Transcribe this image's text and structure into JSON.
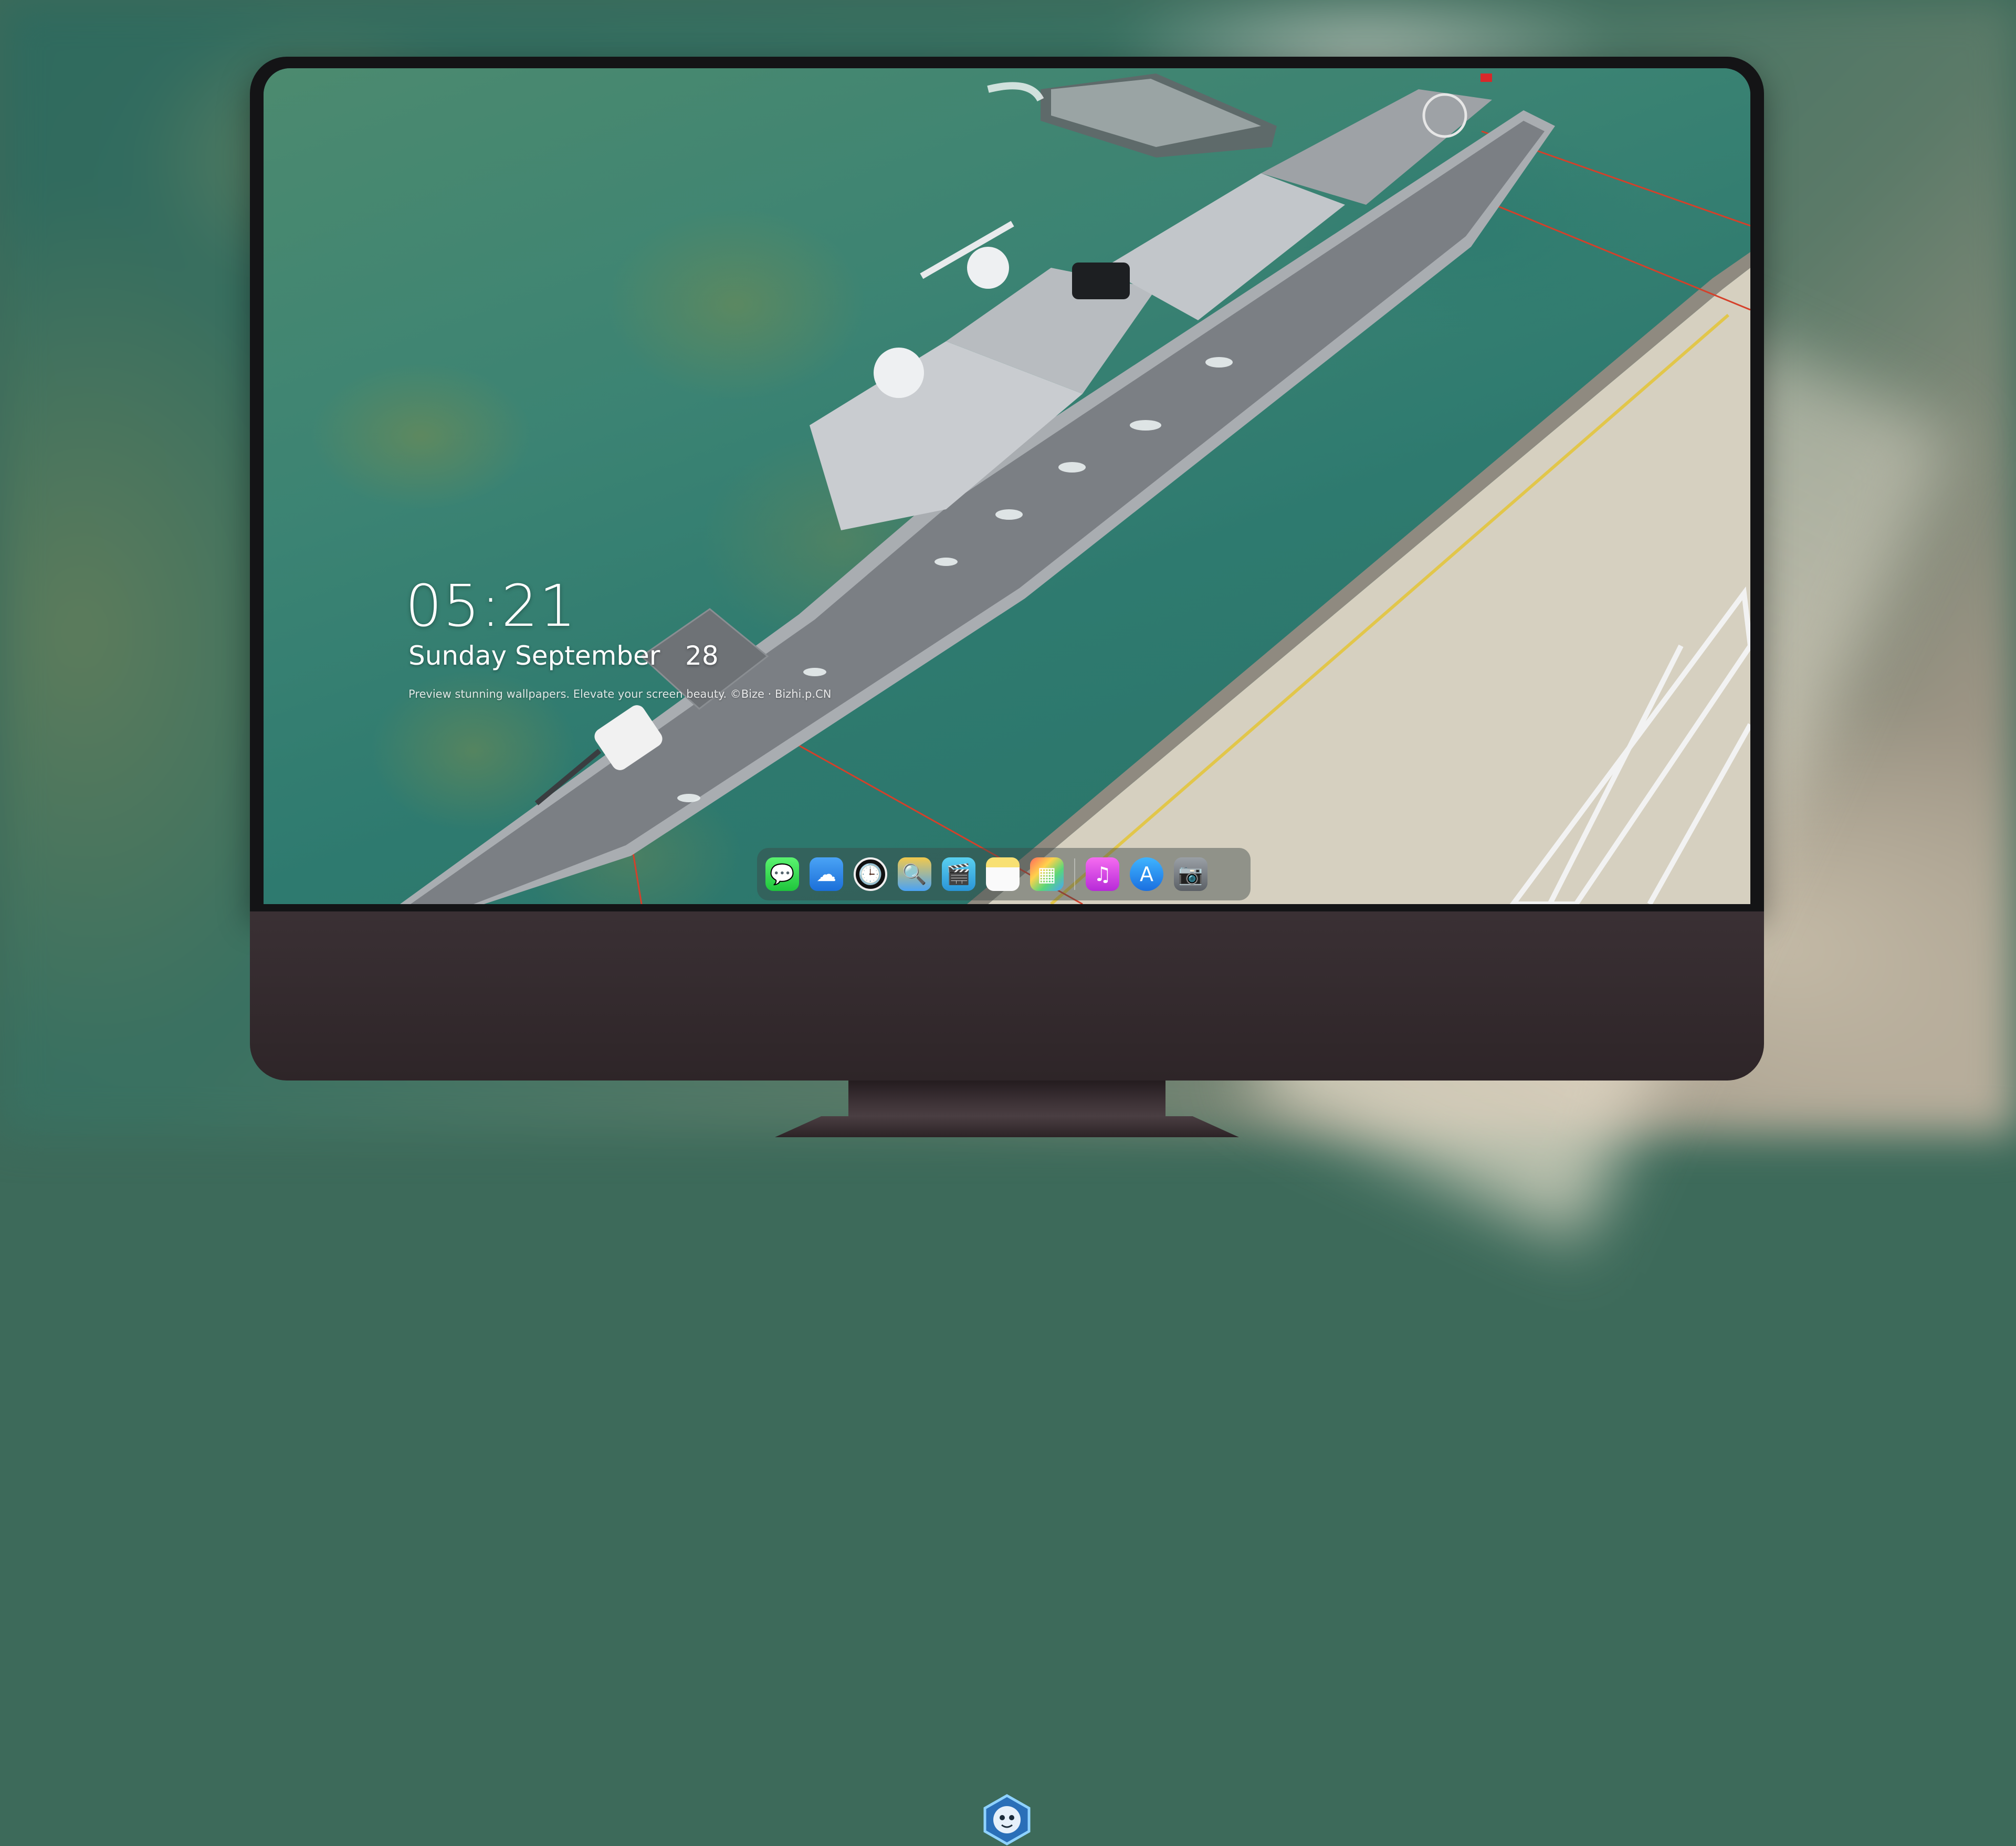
{
  "lockscreen": {
    "time": "05:21",
    "date": "Sunday September   28",
    "tagline": "Preview stunning wallpapers. Elevate your screen beauty.  ©Bize · Bizhi.p.CN"
  },
  "dock": {
    "apps": [
      {
        "name": "Messages",
        "icon": "messages-icon",
        "glyph": "💬"
      },
      {
        "name": "Weather",
        "icon": "weather-icon",
        "glyph": "☁"
      },
      {
        "name": "Clock",
        "icon": "clock-icon",
        "glyph": "🕒"
      },
      {
        "name": "Preview",
        "icon": "preview-icon",
        "glyph": "🔍"
      },
      {
        "name": "Clips",
        "icon": "clips-icon",
        "glyph": "🎬"
      },
      {
        "name": "Notes",
        "icon": "notes-icon",
        "glyph": ""
      },
      {
        "name": "Photo Booth",
        "icon": "photos-icon",
        "glyph": "▦"
      },
      {
        "name": "Music",
        "icon": "music-icon",
        "glyph": "♫"
      },
      {
        "name": "App Store",
        "icon": "app-store-icon",
        "glyph": "A"
      },
      {
        "name": "Camera",
        "icon": "camera-icon",
        "glyph": "📷"
      }
    ]
  },
  "colors": {
    "sea": "#2f7565",
    "bezel": "#141416",
    "chin": "#3a3034"
  }
}
